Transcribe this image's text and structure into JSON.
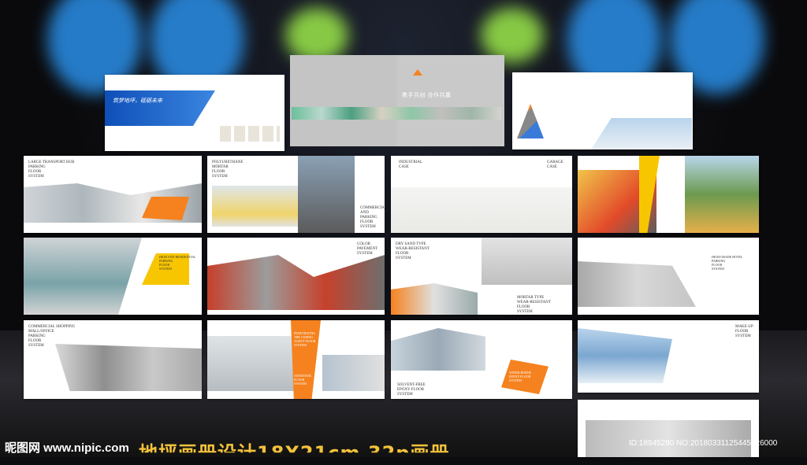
{
  "watermark": {
    "site": "昵图网 www.nipic.com",
    "title": "地坪画册设计18X21cm 32p画册",
    "id_line": "ID:18945290 NO:20180331125445926000"
  },
  "cover": {
    "slogan": "携手共创 合作共赢"
  },
  "pages": {
    "p1_quote": "筑梦地坪，砥砺未来",
    "large_transport": "LARGE TRANSPORT HUB\nPARKING\nFLOOR\nSYSTEM",
    "polyurethane": "POLYURETHANE MORTAR\nFLOOR\nSYSTEM",
    "commercial_parking": "COMMERCIAL\nAND PARKING\nFLOOR\nSYSTEM",
    "industrial_case": "INDUSTRIAL\nCASE",
    "garage_case": "GARAGE\nCASE",
    "high_residential": "HIGH AND RESIDENTIAL\nPARKING\nFLOOR\nSYSTEM",
    "color_pavement": "COLOR\nPAVEMENT\nSYSTEM",
    "dry_sand": "DRY SAND TYPE\nWEAR-RESISTANT\nFLOOR\nSYSTEM",
    "mortar_type": "MORTAR TYPE\nWEAR-RESISTANT\nFLOOR\nSYSTEM",
    "high_grade_hotel": "HIGH-GRADE HOTEL\nPARKING\nFLOOR\nSYSTEM",
    "commercial_shopping": "COMMERCIAL SHOPPING\nMALL/OFFICE\nPARKING\nFLOOR\nSYSTEM",
    "penetrating": "PENETRATING\nTHE CURING\nAGENT FLOOR\nSYSTEM",
    "antistatic": "ANTISTATIC\nFLOOR\nSYSTEM",
    "solvent_free": "SOLVENT-FREE\nEPOXY FLOOR\nSYSTEM",
    "water_borne": "WATER-BORNE\nEPOXY FLOOR\nSYSTEM",
    "make_up": "MAKE-UP\nFLOOR\nSYSTEM"
  },
  "colors": {
    "accent_orange": "#f5821f",
    "accent_yellow": "#f7c600",
    "accent_blue": "#1d5fc8",
    "gray": "#bdbdbd"
  }
}
